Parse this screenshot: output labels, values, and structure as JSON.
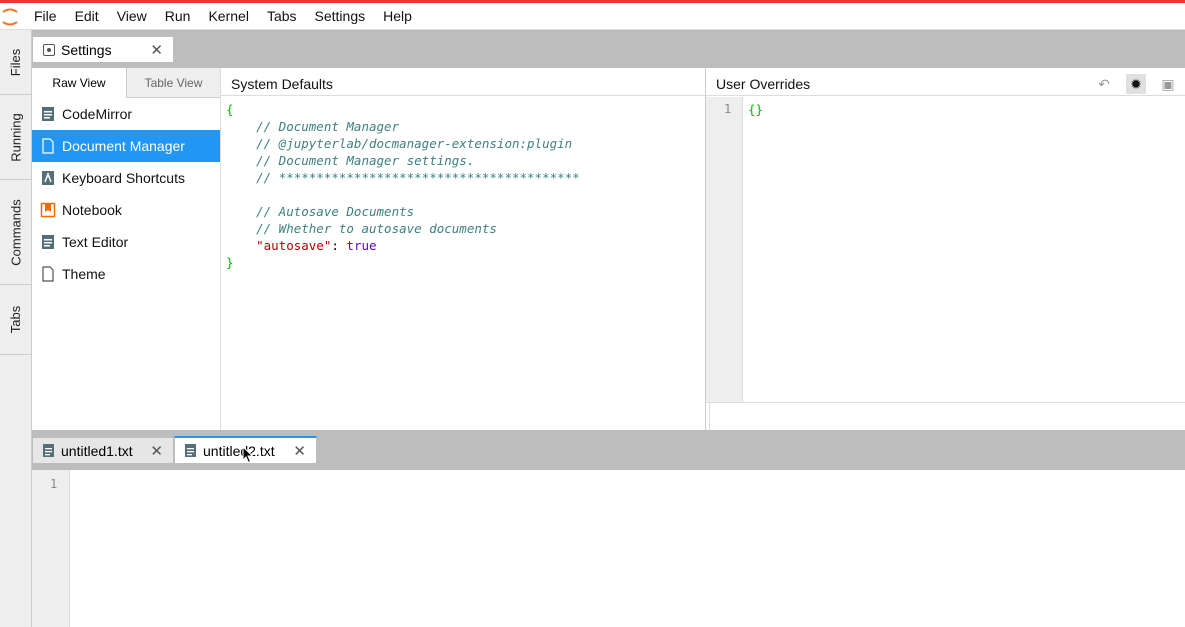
{
  "menu": [
    "File",
    "Edit",
    "View",
    "Run",
    "Kernel",
    "Tabs",
    "Settings",
    "Help"
  ],
  "sidebar_tabs": [
    "Files",
    "Running",
    "Commands",
    "Tabs"
  ],
  "settings_tab": {
    "label": "Settings",
    "close": "✕"
  },
  "settings": {
    "subtabs": {
      "raw": "Raw View",
      "table": "Table View"
    },
    "plugins": [
      {
        "label": "CodeMirror",
        "icon": "text-file-icon"
      },
      {
        "label": "Document Manager",
        "icon": "file-icon"
      },
      {
        "label": "Keyboard Shortcuts",
        "icon": "keyboard-icon"
      },
      {
        "label": "Notebook",
        "icon": "notebook-icon"
      },
      {
        "label": "Text Editor",
        "icon": "text-file-icon"
      },
      {
        "label": "Theme",
        "icon": "file-icon"
      }
    ],
    "selected_plugin": "Document Manager",
    "system_defaults_title": "System Defaults",
    "user_overrides_title": "User Overrides",
    "system_defaults_lines": [
      "{",
      "    // Document Manager",
      "    // @jupyterlab/docmanager-extension:plugin",
      "    // Document Manager settings.",
      "    // ****************************************",
      "",
      "    // Autosave Documents",
      "    // Whether to autosave documents",
      "    \"autosave\": true",
      "}"
    ],
    "user_overrides_line_number": "1",
    "user_overrides_content": "{}"
  },
  "file_tabs": [
    {
      "label": "untitled1.txt",
      "close": "✕"
    },
    {
      "label": "untitled2.txt",
      "close": "✕"
    }
  ],
  "text_editor": {
    "line_number": "1"
  },
  "colors": {
    "accent": "#2196f3",
    "topline": "#e53935"
  }
}
